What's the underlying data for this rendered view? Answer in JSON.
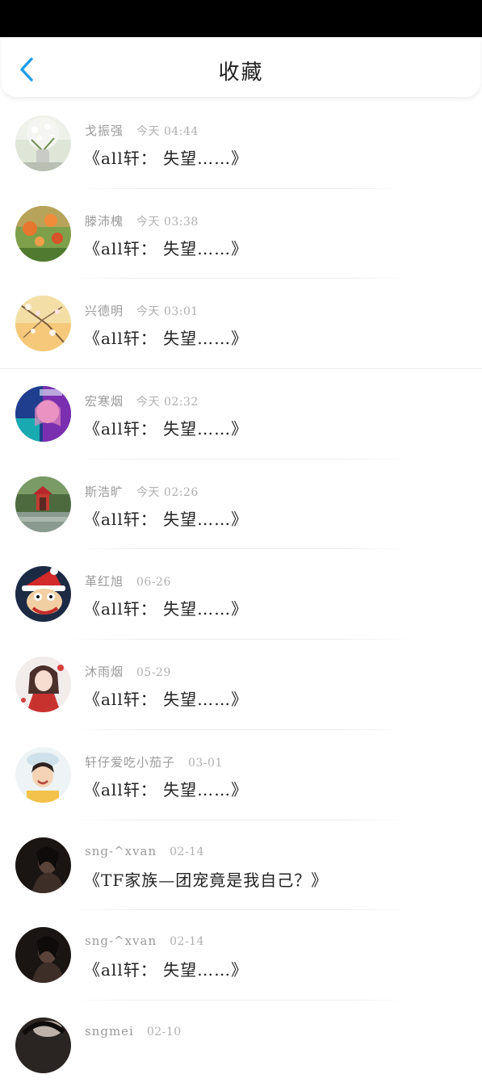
{
  "header": {
    "title": "收藏"
  },
  "colors": {
    "accent": "#1e9ee8",
    "status_bar": "#000000"
  },
  "items": [
    {
      "author": "戈振强",
      "time": "今天 04:44",
      "title": "《all轩： 失望……》",
      "avatar": "white-flowers-vase"
    },
    {
      "author": "滕沛槐",
      "time": "今天 03:38",
      "title": "《all轩： 失望……》",
      "avatar": "orange-flowers-garden"
    },
    {
      "author": "兴德明",
      "time": "今天 03:01",
      "title": "《all轩： 失望……》",
      "avatar": "blossom-branches"
    },
    {
      "author": "宏寒烟",
      "time": "今天 02:32",
      "title": "《all轩： 失望……》",
      "avatar": "girl-neon-light"
    },
    {
      "author": "斯浩旷",
      "time": "今天 02:26",
      "title": "《all轩： 失望……》",
      "avatar": "red-pavilion-pond"
    },
    {
      "author": "革红旭",
      "time": "06-26",
      "title": "《all轩： 失望……》",
      "avatar": "monkey-santa-hat"
    },
    {
      "author": "沐雨烟",
      "time": "05-29",
      "title": "《all轩： 失望……》",
      "avatar": "anime-girl-red-dress"
    },
    {
      "author": "轩仔爱吃小茄子",
      "time": "03-01",
      "title": "《all轩： 失望……》",
      "avatar": "smiling-girl-hat"
    },
    {
      "author": "sng-^xvan",
      "time": "02-14",
      "title": "《TF家族—团宠竟是我自己？》",
      "avatar": "dark-portrait"
    },
    {
      "author": "sng-^xvan",
      "time": "02-14",
      "title": "《all轩： 失望……》",
      "avatar": "dark-portrait"
    },
    {
      "author": "sngmei",
      "time": "02-10",
      "title": "",
      "avatar": "dark-portrait-partial"
    }
  ]
}
